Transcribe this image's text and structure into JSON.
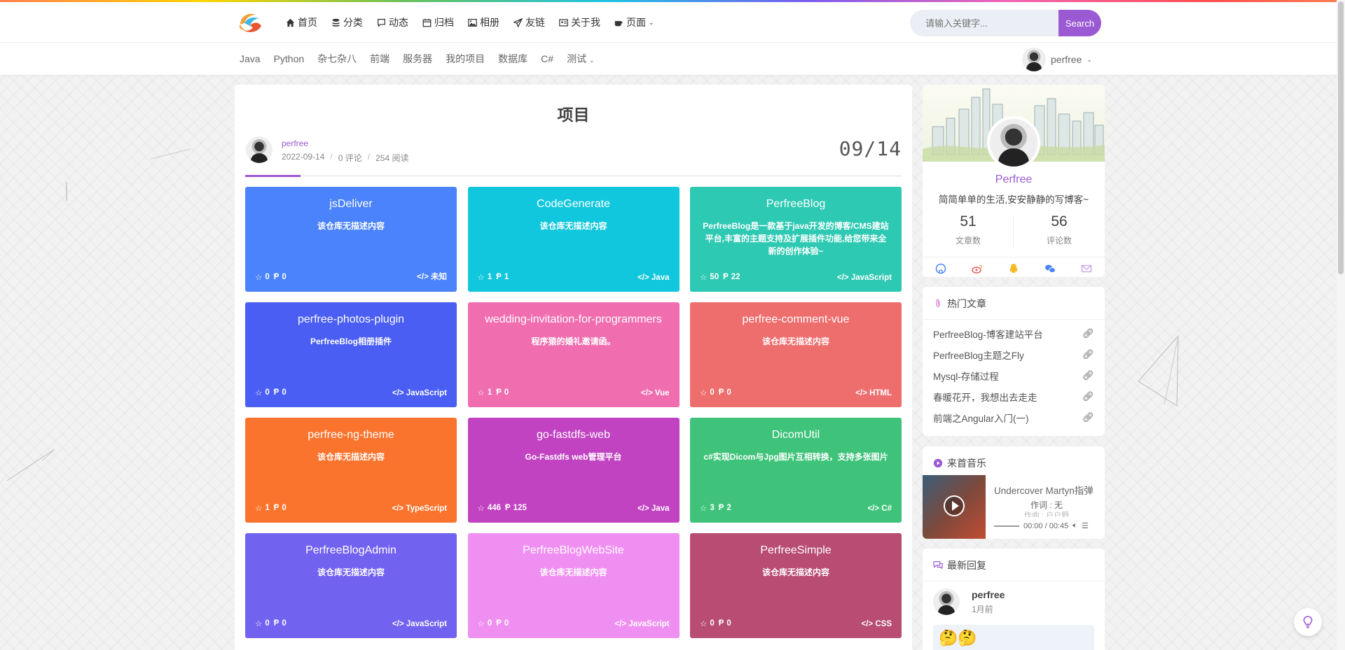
{
  "nav": {
    "items": [
      {
        "label": "首页",
        "icon": "home-icon"
      },
      {
        "label": "分类",
        "icon": "layers-icon"
      },
      {
        "label": "动态",
        "icon": "chat-icon"
      },
      {
        "label": "归档",
        "icon": "calendar-icon"
      },
      {
        "label": "相册",
        "icon": "image-icon"
      },
      {
        "label": "友链",
        "icon": "send-icon"
      },
      {
        "label": "关于我",
        "icon": "id-card-icon"
      },
      {
        "label": "页面",
        "icon": "coffee-icon"
      }
    ],
    "search_placeholder": "请输入关键字...",
    "search_button": "Search"
  },
  "subnav": {
    "items": [
      "Java",
      "Python",
      "杂七杂八",
      "前端",
      "服务器",
      "我的项目",
      "数据库",
      "C#",
      "测试"
    ],
    "user": "perfree"
  },
  "article": {
    "title": "项目",
    "author": "perfree",
    "date": "2022-09-14",
    "comments": "0 评论",
    "reads": "254 阅读",
    "big_date": "09/14"
  },
  "projects": [
    {
      "title": "jsDeliver",
      "desc": "该仓库无描述内容",
      "stars": "0",
      "forks": "0",
      "lang": "未知",
      "color": "#4a83fb"
    },
    {
      "title": "CodeGenerate",
      "desc": "该仓库无描述内容",
      "stars": "1",
      "forks": "1",
      "lang": "Java",
      "color": "#11c7dd"
    },
    {
      "title": "PerfreeBlog",
      "desc": "PerfreeBlog是一款基于java开发的博客/CMS建站平台,丰富的主题支持及扩展插件功能,给您带来全新的创作体验~",
      "stars": "50",
      "forks": "22",
      "lang": "JavaScript",
      "color": "#2ec9b3"
    },
    {
      "title": "perfree-photos-plugin",
      "desc": "PerfreeBlog相册插件",
      "stars": "0",
      "forks": "0",
      "lang": "JavaScript",
      "color": "#4a5ef3"
    },
    {
      "title": "wedding-invitation-for-programmers",
      "desc": "程序猿的婚礼邀请函。",
      "stars": "1",
      "forks": "0",
      "lang": "Vue",
      "color": "#f06eb0"
    },
    {
      "title": "perfree-comment-vue",
      "desc": "该仓库无描述内容",
      "stars": "0",
      "forks": "0",
      "lang": "HTML",
      "color": "#ee6e6e"
    },
    {
      "title": "perfree-ng-theme",
      "desc": "该仓库无描述内容",
      "stars": "1",
      "forks": "0",
      "lang": "TypeScript",
      "color": "#fb742e"
    },
    {
      "title": "go-fastdfs-web",
      "desc": "Go-Fastdfs web管理平台",
      "stars": "446",
      "forks": "125",
      "lang": "Java",
      "color": "#c143c2"
    },
    {
      "title": "DicomUtil",
      "desc": "c#实现Dicom与Jpg图片互相转换，支持多张图片",
      "stars": "3",
      "forks": "2",
      "lang": "C#",
      "color": "#3fc37a"
    },
    {
      "title": "PerfreeBlogAdmin",
      "desc": "该仓库无描述内容",
      "stars": "0",
      "forks": "0",
      "lang": "JavaScript",
      "color": "#7262f0"
    },
    {
      "title": "PerfreeBlogWebSite",
      "desc": "该仓库无描述内容",
      "stars": "0",
      "forks": "0",
      "lang": "JavaScript",
      "color": "#f08ff2"
    },
    {
      "title": "PerfreeSimple",
      "desc": "该仓库无描述内容",
      "stars": "0",
      "forks": "0",
      "lang": "CSS",
      "color": "#b84c73"
    }
  ],
  "profile": {
    "name": "Perfree",
    "motto": "简简单单的生活,安安静静的写博客~",
    "articles": "51",
    "articles_label": "文章数",
    "comments": "56",
    "comments_label": "评论数",
    "social": [
      "github-icon",
      "weibo-icon",
      "qq-icon",
      "wechat-icon",
      "mail-icon"
    ]
  },
  "hot": {
    "title": "热门文章",
    "items": [
      "PerfreeBlog-博客建站平台",
      "PerfreeBlog主题之Fly",
      "Mysql-存储过程",
      "春暖花开，我想出去走走",
      "前端之Angular入门(一)"
    ]
  },
  "music": {
    "title": "来首音乐",
    "song": "Undercover Martyn指弹",
    "lyric1": "作词 : 无",
    "lyric2": "作曲 : 户户野",
    "time": "00:00 / 00:45"
  },
  "reply": {
    "title": "最新回复",
    "name": "perfree",
    "time": "1月前",
    "content": "🤔🤔"
  },
  "colors": {
    "accent": "#9b59d3"
  }
}
